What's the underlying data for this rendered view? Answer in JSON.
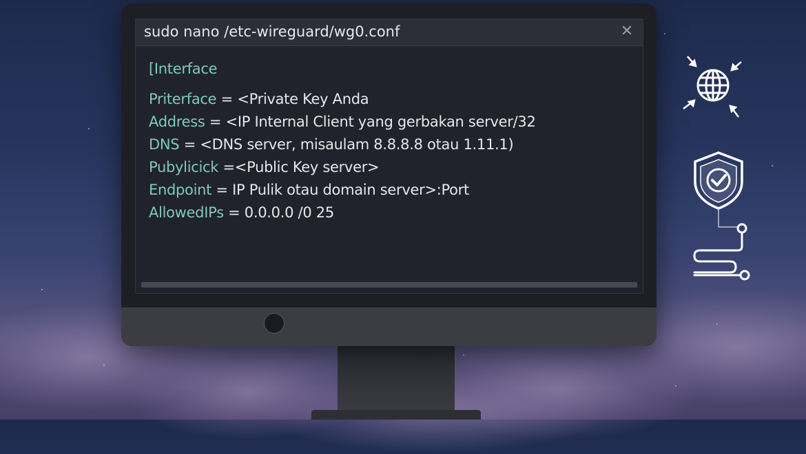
{
  "window": {
    "title": "sudo nano /etc-wireguard/wg0.conf",
    "close_icon": "close-icon"
  },
  "editor": {
    "section_header": "[Interface",
    "lines": [
      {
        "key": "Priterface",
        "sep": " = ",
        "value": "<Private Key Anda"
      },
      {
        "key": "Address",
        "sep": " = ",
        "value": "<IP Internal Client yang gerbakan server/32"
      },
      {
        "key": "DNS",
        "sep": " = ",
        "value": "<DNS server, misaulam 8.8.8.8 otau 1.11.1)"
      },
      {
        "key": "Pubylicick",
        "sep": " =",
        "value": "<Public Key server>"
      },
      {
        "key": "Endpoint",
        "sep": " = ",
        "value": "IP Pulik otau domain server>:Port"
      },
      {
        "key": "AllowedIPs",
        "sep": " = ",
        "value": "0.0.0.0 /0  25"
      }
    ]
  },
  "side_icons": [
    "globe-arrows-icon",
    "shield-check-icon",
    "network-route-icon"
  ],
  "colors": {
    "key_text": "#7ec9c0",
    "value_text": "#e6e7ea",
    "terminal_bg": "#20232b",
    "titlebar_bg": "#2c2f37"
  }
}
